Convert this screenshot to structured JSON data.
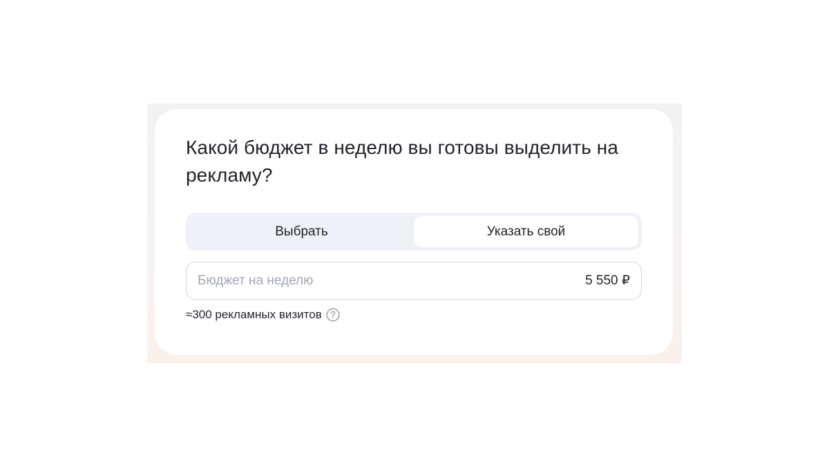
{
  "question": {
    "title": "Какой бюджет в неделю вы готовы выделить на рекламу?"
  },
  "budget_mode": {
    "options": [
      {
        "label": "Выбрать",
        "selected": false
      },
      {
        "label": "Указать свой",
        "selected": true
      }
    ]
  },
  "budget_field": {
    "label": "Бюджет на неделю",
    "value": "5 550 ₽"
  },
  "estimate": {
    "text": "≈300 рекламных визитов",
    "help_icon": "question-circle-icon"
  },
  "colors": {
    "text_primary": "#1f2229",
    "text_muted": "#a0a6b4",
    "toggle_bg": "#eef1f6",
    "field_border": "#cdd2dc",
    "icon_gray": "#a0a6b4"
  }
}
